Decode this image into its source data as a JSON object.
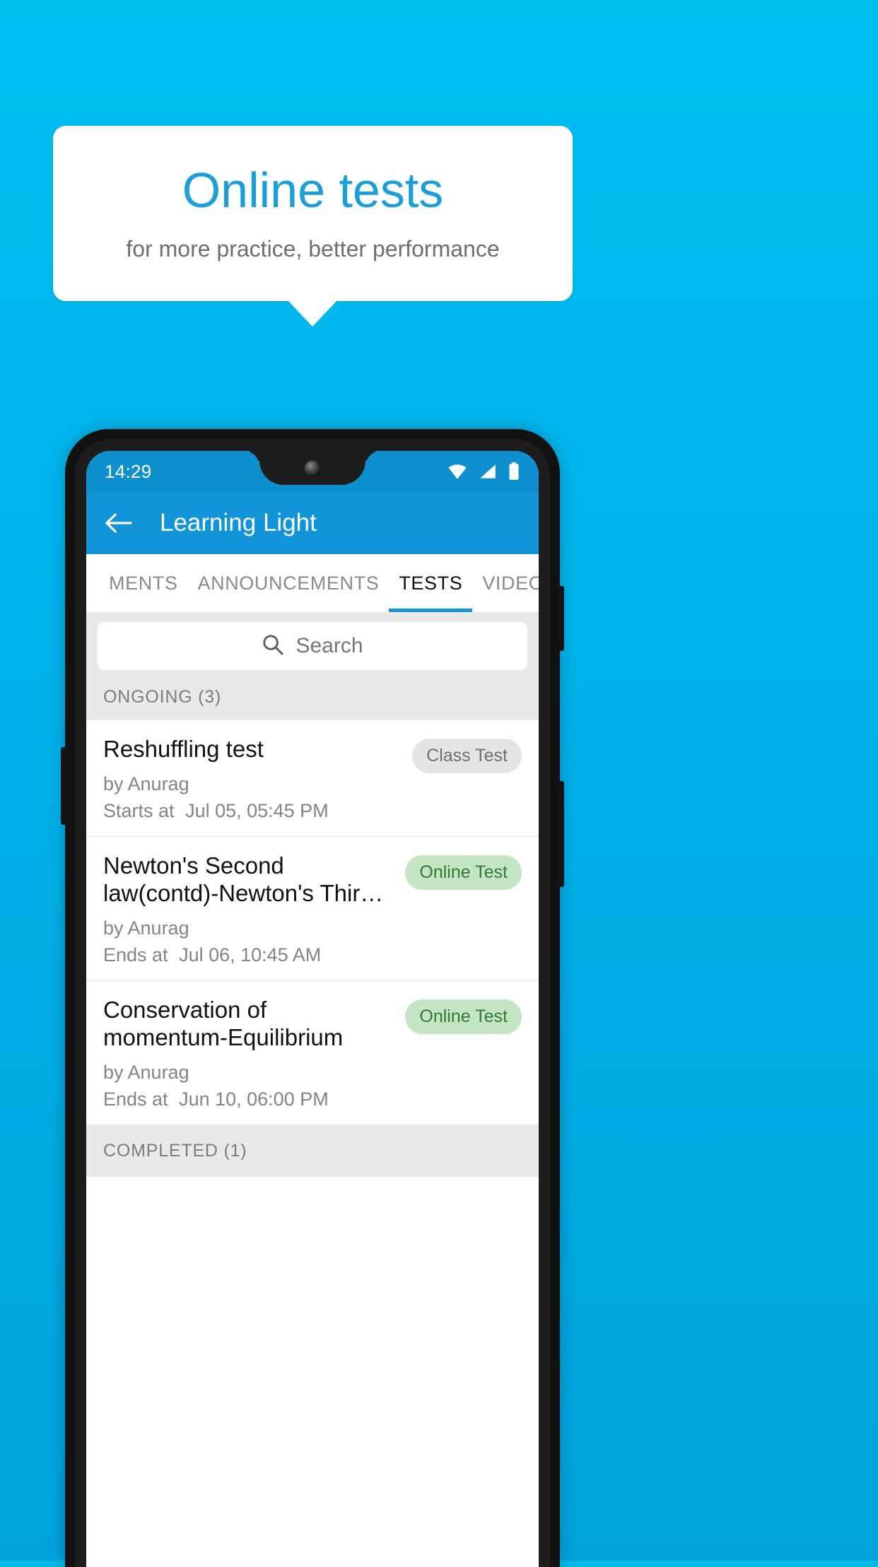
{
  "promo": {
    "title": "Online tests",
    "subtitle": "for more practice, better performance"
  },
  "colors": {
    "background": "#00b5ec",
    "brand_blue": "#1295d8",
    "title_blue": "#1a9fd9",
    "statusbar_blue": "#0d90cd",
    "badge_gray_bg": "#e4e4e4",
    "badge_gray_text": "#6f6f6f",
    "badge_green_bg": "#c5e6c5",
    "badge_green_text": "#317a31"
  },
  "phone": {
    "statusbar": {
      "time": "14:29",
      "icons": [
        "wifi-icon",
        "signal-icon",
        "battery-icon"
      ]
    },
    "appbar": {
      "back_icon": "back-arrow-icon",
      "title": "Learning Light"
    },
    "tabs": [
      {
        "label": "MENTS",
        "active": false
      },
      {
        "label": "ANNOUNCEMENTS",
        "active": false
      },
      {
        "label": "TESTS",
        "active": true
      },
      {
        "label": "VIDEOS",
        "active": false
      }
    ],
    "search": {
      "icon": "search-icon",
      "placeholder": "Search",
      "value": ""
    },
    "sections": [
      {
        "label": "ONGOING (3)"
      },
      {
        "label": "COMPLETED (1)"
      }
    ],
    "tests": [
      {
        "title": "Reshuffling test",
        "author": "by Anurag",
        "time_label": "Starts at",
        "time_value": "Jul 05, 05:45 PM",
        "badge": "Class Test",
        "badge_style": "gray"
      },
      {
        "title": "Newton's Second law(contd)-Newton's Thir…",
        "author": "by Anurag",
        "time_label": "Ends at",
        "time_value": "Jul 06, 10:45 AM",
        "badge": "Online Test",
        "badge_style": "green"
      },
      {
        "title": "Conservation of momentum-Equilibrium",
        "author": "by Anurag",
        "time_label": "Ends at",
        "time_value": "Jun 10, 06:00 PM",
        "badge": "Online Test",
        "badge_style": "green"
      }
    ]
  }
}
